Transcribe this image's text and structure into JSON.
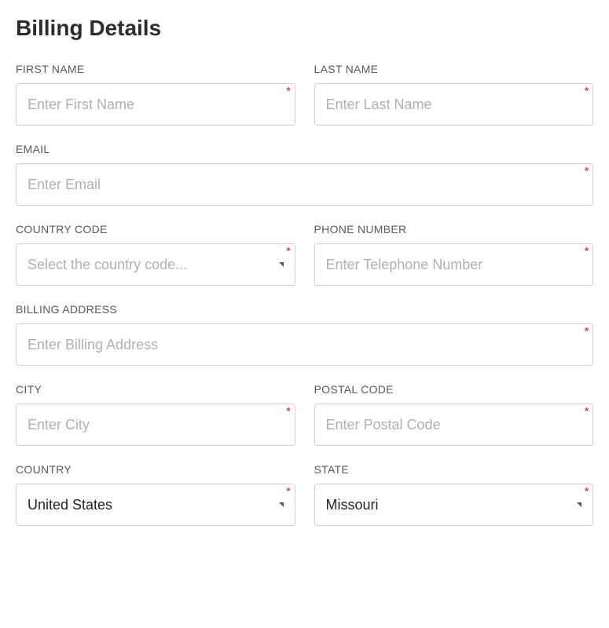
{
  "title": "Billing Details",
  "fields": {
    "first_name": {
      "label": "FIRST NAME",
      "placeholder": "Enter First Name",
      "value": ""
    },
    "last_name": {
      "label": "LAST NAME",
      "placeholder": "Enter Last Name",
      "value": ""
    },
    "email": {
      "label": "EMAIL",
      "placeholder": "Enter Email",
      "value": ""
    },
    "country_code": {
      "label": "COUNTRY CODE",
      "placeholder": "Select the country code...",
      "value": ""
    },
    "phone": {
      "label": "PHONE NUMBER",
      "placeholder": "Enter Telephone Number",
      "value": ""
    },
    "billing_address": {
      "label": "BILLING ADDRESS",
      "placeholder": "Enter Billing Address",
      "value": ""
    },
    "city": {
      "label": "CITY",
      "placeholder": "Enter City",
      "value": ""
    },
    "postal_code": {
      "label": "POSTAL CODE",
      "placeholder": "Enter Postal Code",
      "value": ""
    },
    "country": {
      "label": "COUNTRY",
      "value": "United States"
    },
    "state": {
      "label": "STATE",
      "value": "Missouri"
    }
  },
  "required_marker": "*"
}
